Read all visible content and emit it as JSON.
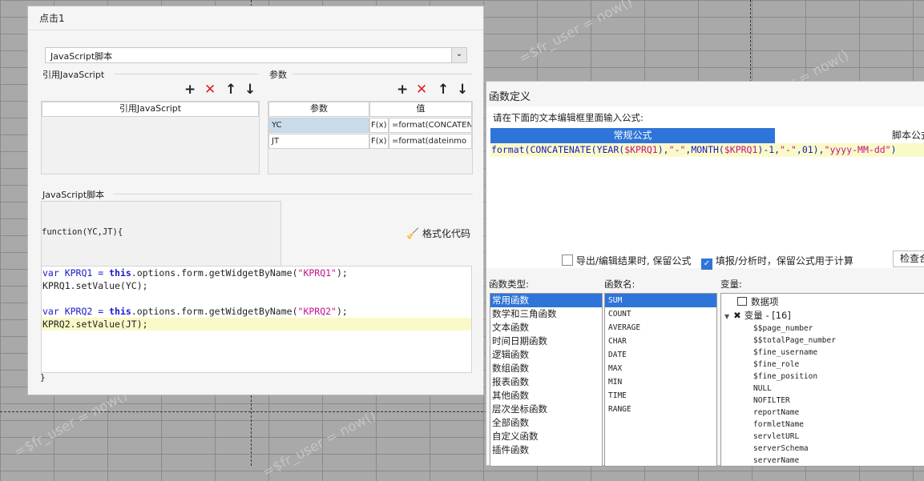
{
  "background": {
    "watermarks": [
      "=$fr_user = now()",
      "=$fr_user = now()",
      "=$fr_user = now()",
      "=$fr_user = now()"
    ]
  },
  "dialog1": {
    "title": "点击1",
    "script_type": "JavaScript脚本",
    "ref_section_label": "引用JavaScript",
    "param_section_label": "参数",
    "ref_table_header": "引用JavaScript",
    "param_table": {
      "headers": [
        "参数",
        "值"
      ],
      "rows": [
        {
          "name": "YC",
          "formula_icon": "F(x)",
          "value": "=format(CONCATEN"
        },
        {
          "name": "JT",
          "formula_icon": "F(x)",
          "value": "=format(dateinmo"
        }
      ]
    },
    "script_section_label": "JavaScript脚本",
    "function_signature": "function(YC,JT){",
    "format_code_label": "格式化代码",
    "code": {
      "l1_pre": "var KPRQ1 = ",
      "l1_kw": "this",
      "l1_mid": ".options.form.getWidgetByName(",
      "l1_str": "\"KPRQ1\"",
      "l1_end": ");",
      "l2": "KPRQ1.setValue(YC);",
      "l4_pre": "var KPRQ2 = ",
      "l4_kw": "this",
      "l4_mid": ".options.form.getWidgetByName(",
      "l4_str": "\"KPRQ2\"",
      "l4_end": ");",
      "l5": "KPRQ2.setValue(JT);"
    },
    "closing_brace": "}"
  },
  "dialog2": {
    "title": "函数定义",
    "instruction": "请在下面的文本编辑框里面输入公式:",
    "tabs": [
      "常规公式",
      "脚本公式"
    ],
    "formula": {
      "p1": "format(",
      "p2": "CONCATENATE(",
      "p3": "YEAR(",
      "p4": "$KPRQ1",
      "p5": "),",
      "p6": "\"-\"",
      "p7": ",",
      "p8": "MONTH(",
      "p9": "$KPRQ1",
      "p10": ")-1,",
      "p11": "\"-\"",
      "p12": ",01),",
      "p13": "\"yyyy-MM-dd\"",
      "p14": ")"
    },
    "option_export_label": "导出/编辑结果时, 保留公式",
    "option_fill_label": "填报/分析时，保留公式用于计算",
    "check_button_label": "检查合法性",
    "category_label": "函数类型:",
    "function_name_label": "函数名:",
    "variable_label": "变量:",
    "categories": [
      "常用函数",
      "数学和三角函数",
      "文本函数",
      "时间日期函数",
      "逻辑函数",
      "数组函数",
      "报表函数",
      "其他函数",
      "层次坐标函数",
      "全部函数",
      "自定义函数",
      "插件函数"
    ],
    "functions": [
      "SUM",
      "COUNT",
      "AVERAGE",
      "CHAR",
      "DATE",
      "MAX",
      "MIN",
      "TIME",
      "RANGE"
    ],
    "variables": {
      "data_item": "数据项",
      "group_label": "变量 - [16]",
      "items": [
        "$$page_number",
        "$$totalPage_number",
        "$fine_username",
        "$fine_role",
        "$fine_position",
        "NULL",
        "NOFILTER",
        "reportName",
        "formletName",
        "servletURL",
        "serverSchema",
        "serverName"
      ]
    }
  }
}
